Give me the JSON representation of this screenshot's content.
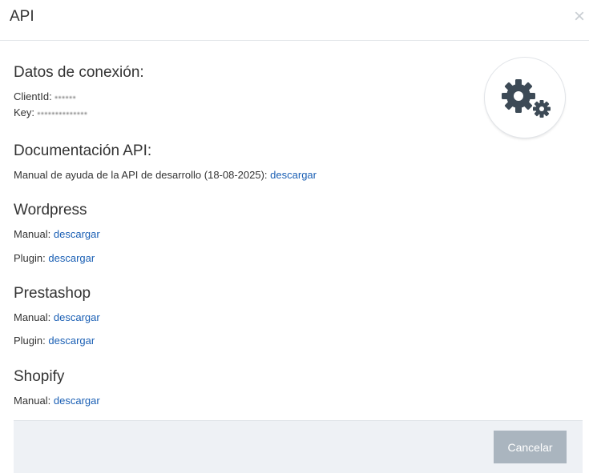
{
  "header": {
    "title": "API",
    "close_glyph": "×"
  },
  "connection": {
    "heading": "Datos de conexión:",
    "client_id_label": "ClientId:",
    "client_id_value": "••••••",
    "key_label": "Key:",
    "key_value": "••••••••••••••"
  },
  "docs": {
    "heading": "Documentación API:",
    "manual_label": "Manual de ayuda de la API de desarrollo (18-08-2025):",
    "manual_link": "descargar"
  },
  "wordpress": {
    "heading": "Wordpress",
    "manual_label": "Manual:",
    "manual_link": "descargar",
    "plugin_label": "Plugin:",
    "plugin_link": "descargar"
  },
  "prestashop": {
    "heading": "Prestashop",
    "manual_label": "Manual:",
    "manual_link": "descargar",
    "plugin_label": "Plugin:",
    "plugin_link": "descargar"
  },
  "shopify": {
    "heading": "Shopify",
    "manual_label": "Manual:",
    "manual_link": "descargar"
  },
  "footer": {
    "cancel_label": "Cancelar"
  },
  "icons": {
    "settings": "gears-icon"
  },
  "colors": {
    "link": "#1a5fb4",
    "button": "#aab5bf",
    "gear": "#3d4a56"
  }
}
